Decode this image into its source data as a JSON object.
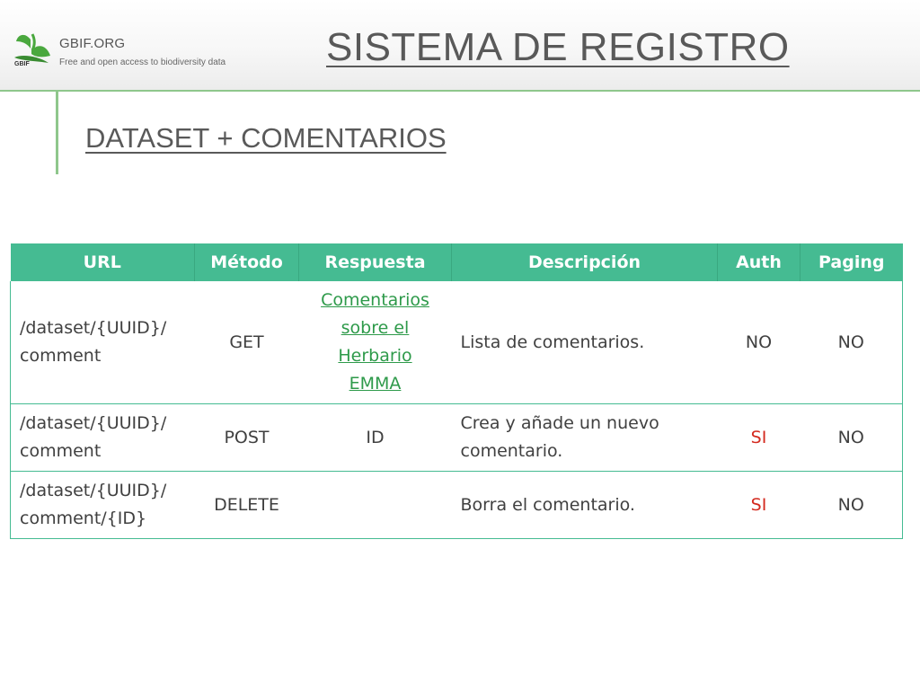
{
  "header": {
    "logo_word": "GBIF",
    "logo_title": "GBIF.ORG",
    "logo_tagline": "Free and open access to biodiversity data",
    "title": "SISTEMA DE REGISTRO"
  },
  "subtitle": "DATASET + COMENTARIOS",
  "colors": {
    "accent_green": "#45bb92",
    "link_green": "#2e9a4a",
    "header_rule": "#8fc78c",
    "warning_red": "#d42a1f"
  },
  "table": {
    "headers": [
      "URL",
      "Método",
      "Respuesta",
      "Descripción",
      "Auth",
      "Paging"
    ],
    "rows": [
      {
        "url_line1": "/dataset/{UUID}/",
        "url_line2": "comment",
        "method": "GET",
        "response_lines": [
          "Comentarios",
          "sobre el",
          "Herbario",
          "EMMA"
        ],
        "description": "Lista de comentarios.",
        "auth": "NO",
        "paging": "NO"
      },
      {
        "url_line1": "/dataset/{UUID}/",
        "url_line2": "comment",
        "method": "POST",
        "response": "ID",
        "description_line1": "Crea y añade un nuevo",
        "description_line2": "comentario.",
        "auth": "SI",
        "paging": "NO"
      },
      {
        "url_line1": "/dataset/{UUID}/",
        "url_line2": "comment/{ID}",
        "method": "DELETE",
        "response": "",
        "description": "Borra el comentario.",
        "auth": "SI",
        "paging": "NO"
      }
    ]
  }
}
